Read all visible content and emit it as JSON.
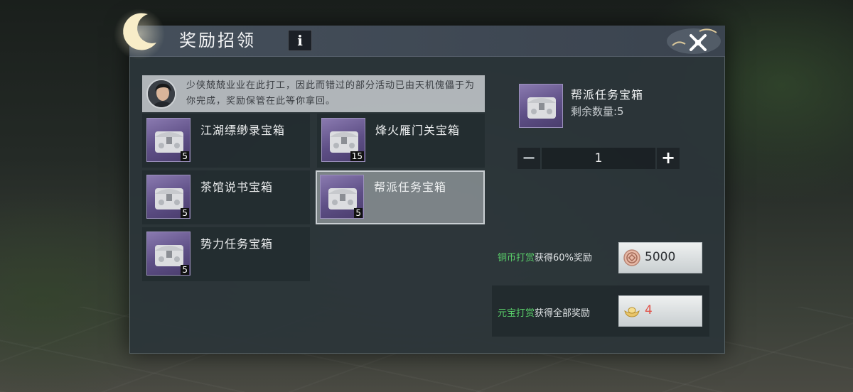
{
  "window": {
    "title": "奖励招领",
    "info_label": "i"
  },
  "notice": {
    "text": "少侠兢兢业业在此打工，因此而错过的部分活动已由天机傀儡于为你完成，奖励保管在此等你拿回。"
  },
  "chests": [
    {
      "name": "江湖缥缈录宝箱",
      "count": "5"
    },
    {
      "name": "烽火雁门关宝箱",
      "count": "15"
    },
    {
      "name": "茶馆说书宝箱",
      "count": "5"
    },
    {
      "name": "帮派任务宝箱",
      "count": "5",
      "selected": true
    },
    {
      "name": "势力任务宝箱",
      "count": "5"
    }
  ],
  "detail": {
    "name": "帮派任务宝箱",
    "remaining": "剩余数量:5"
  },
  "stepper": {
    "minus": "−",
    "value": "1",
    "plus": "+"
  },
  "rewards": {
    "copper": {
      "label_highlight": "铜币打赏",
      "label_rest": "获得60%奖励",
      "amount": "5000",
      "icon": "copper-coin-icon"
    },
    "ingot": {
      "label_highlight": "元宝打赏",
      "label_rest": "获得全部奖励",
      "amount": "4",
      "icon": "yuanbao-ingot-icon"
    }
  },
  "colors": {
    "panel_bg": "#2c3539",
    "highlight_green": "#5ad06a",
    "ingot_amount_red": "#e0534a",
    "chest_purple": "#5e4f86"
  }
}
